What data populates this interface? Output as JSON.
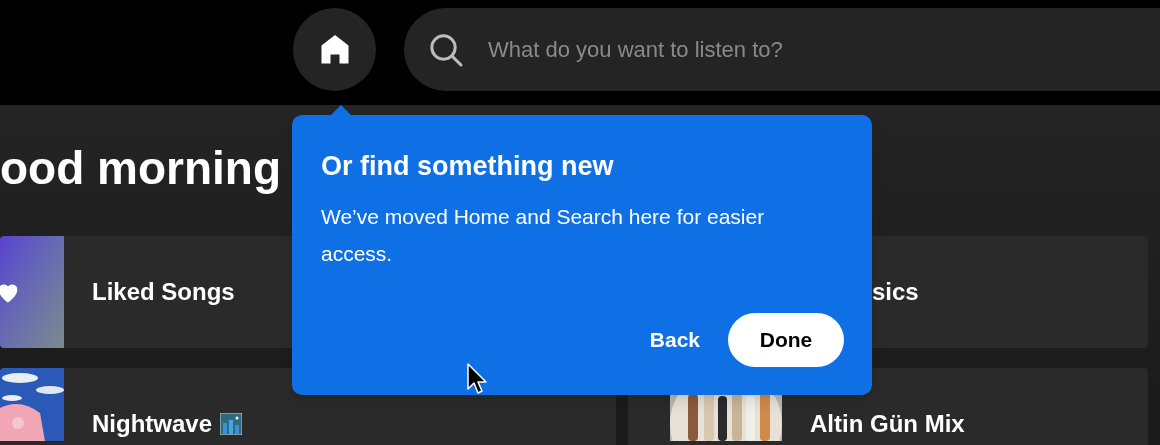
{
  "search": {
    "placeholder": "What do you want to listen to?"
  },
  "heading": "ood morning",
  "cards": [
    {
      "title": "Liked Songs",
      "kind": "heart"
    },
    {
      "title": "sics",
      "kind": "covered"
    },
    {
      "title": "Nightwave",
      "kind": "picture",
      "emoji": true
    },
    {
      "title": "Altin Gün Mix"
    }
  ],
  "popover": {
    "title": "Or find something new",
    "body": "We’ve moved Home and Search here for easier access.",
    "buttons": [
      {
        "label": "Back",
        "kind": "text"
      },
      {
        "label": "Done",
        "kind": "pill"
      }
    ]
  }
}
